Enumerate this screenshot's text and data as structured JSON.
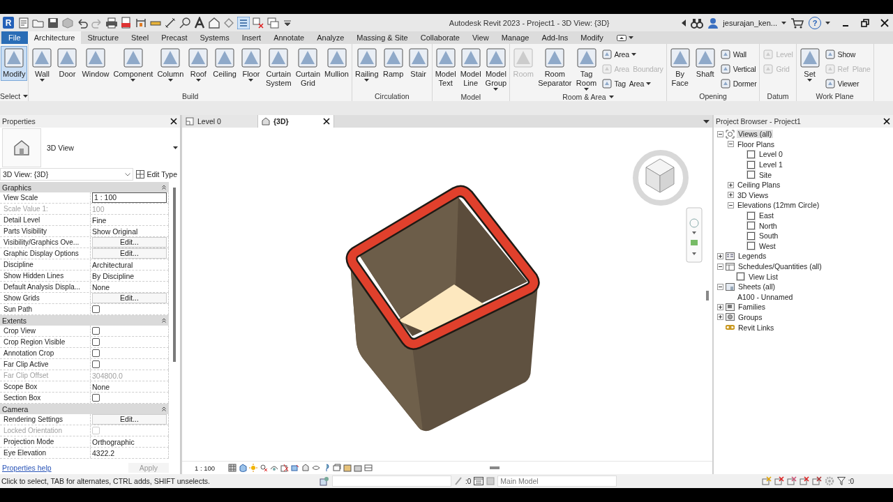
{
  "window": {
    "app_logo": "R",
    "title": "Autodesk Revit 2023 - Project1 - 3D View: {3D}",
    "user": "jesurajan_ken...",
    "help_label": "?"
  },
  "ribbon_tabs": [
    {
      "label": "File",
      "kind": "file",
      "selected": false
    },
    {
      "label": "Architecture",
      "kind": "tab",
      "selected": true
    },
    {
      "label": "Structure",
      "kind": "tab",
      "selected": false
    },
    {
      "label": "Steel",
      "kind": "tab",
      "selected": false
    },
    {
      "label": "Precast",
      "kind": "tab",
      "selected": false
    },
    {
      "label": "Systems",
      "kind": "tab",
      "selected": false
    },
    {
      "label": "Insert",
      "kind": "tab",
      "selected": false
    },
    {
      "label": "Annotate",
      "kind": "tab",
      "selected": false
    },
    {
      "label": "Analyze",
      "kind": "tab",
      "selected": false
    },
    {
      "label": "Massing & Site",
      "kind": "tab",
      "selected": false
    },
    {
      "label": "Collaborate",
      "kind": "tab",
      "selected": false
    },
    {
      "label": "View",
      "kind": "tab",
      "selected": false
    },
    {
      "label": "Manage",
      "kind": "tab",
      "selected": false
    },
    {
      "label": "Add-Ins",
      "kind": "tab",
      "selected": false
    },
    {
      "label": "Modify",
      "kind": "tab",
      "selected": false
    }
  ],
  "ribbon_panels": [
    {
      "title": "Select",
      "has_menu": true,
      "tools": [
        {
          "label": "Modify",
          "kind": "large",
          "selected": true,
          "disabled": false,
          "dropdown": false
        }
      ]
    },
    {
      "title": "Build",
      "has_menu": false,
      "tools": [
        {
          "label": "Wall",
          "kind": "large",
          "selected": false,
          "disabled": false,
          "dropdown": true
        },
        {
          "label": "Door",
          "kind": "large",
          "selected": false,
          "disabled": false,
          "dropdown": false
        },
        {
          "label": "Window",
          "kind": "large",
          "selected": false,
          "disabled": false,
          "dropdown": false
        },
        {
          "label": "Component",
          "kind": "large",
          "selected": false,
          "disabled": false,
          "dropdown": true
        },
        {
          "label": "Column",
          "kind": "large",
          "selected": false,
          "disabled": false,
          "dropdown": true
        },
        {
          "label": "Roof",
          "kind": "large",
          "selected": false,
          "disabled": false,
          "dropdown": true
        },
        {
          "label": "Ceiling",
          "kind": "large",
          "selected": false,
          "disabled": false,
          "dropdown": false
        },
        {
          "label": "Floor",
          "kind": "large",
          "selected": false,
          "disabled": false,
          "dropdown": true
        },
        {
          "label": "Curtain\nSystem",
          "kind": "large",
          "selected": false,
          "disabled": false,
          "dropdown": false
        },
        {
          "label": "Curtain\nGrid",
          "kind": "large",
          "selected": false,
          "disabled": false,
          "dropdown": false
        },
        {
          "label": "Mullion",
          "kind": "large",
          "selected": false,
          "disabled": false,
          "dropdown": false
        }
      ]
    },
    {
      "title": "Circulation",
      "has_menu": false,
      "tools": [
        {
          "label": "Railing",
          "kind": "large",
          "selected": false,
          "disabled": false,
          "dropdown": true
        },
        {
          "label": "Ramp",
          "kind": "large",
          "selected": false,
          "disabled": false,
          "dropdown": false
        },
        {
          "label": "Stair",
          "kind": "large",
          "selected": false,
          "disabled": false,
          "dropdown": false
        }
      ]
    },
    {
      "title": "Model",
      "has_menu": false,
      "tools": [
        {
          "label": "Model\nText",
          "kind": "large",
          "selected": false,
          "disabled": false,
          "dropdown": false
        },
        {
          "label": "Model\nLine",
          "kind": "large",
          "selected": false,
          "disabled": false,
          "dropdown": false
        },
        {
          "label": "Model\nGroup",
          "kind": "large",
          "selected": false,
          "disabled": false,
          "dropdown": true
        }
      ]
    },
    {
      "title": "Room & Area",
      "has_menu": true,
      "tools": [
        {
          "label": "Room",
          "kind": "large",
          "selected": false,
          "disabled": true,
          "dropdown": false
        },
        {
          "label": "Room\nSeparator",
          "kind": "large",
          "selected": false,
          "disabled": false,
          "dropdown": false
        },
        {
          "label": "Tag\nRoom",
          "kind": "large",
          "selected": false,
          "disabled": false,
          "dropdown": true
        },
        {
          "label": "Area",
          "kind": "small",
          "selected": false,
          "disabled": false,
          "dropdown": true
        },
        {
          "label": "Area  Boundary",
          "kind": "small",
          "selected": false,
          "disabled": true,
          "dropdown": false
        },
        {
          "label": "Tag  Area",
          "kind": "small",
          "selected": false,
          "disabled": false,
          "dropdown": true
        }
      ]
    },
    {
      "title": "Opening",
      "has_menu": false,
      "tools": [
        {
          "label": "By\nFace",
          "kind": "large",
          "selected": false,
          "disabled": false,
          "dropdown": false
        },
        {
          "label": "Shaft",
          "kind": "large",
          "selected": false,
          "disabled": false,
          "dropdown": false
        },
        {
          "label": "Wall",
          "kind": "small",
          "selected": false,
          "disabled": false,
          "dropdown": false
        },
        {
          "label": "Vertical",
          "kind": "small",
          "selected": false,
          "disabled": false,
          "dropdown": false
        },
        {
          "label": "Dormer",
          "kind": "small",
          "selected": false,
          "disabled": false,
          "dropdown": false
        }
      ]
    },
    {
      "title": "Datum",
      "has_menu": false,
      "tools": [
        {
          "label": "Level",
          "kind": "small",
          "selected": false,
          "disabled": true,
          "dropdown": false
        },
        {
          "label": "Grid",
          "kind": "small",
          "selected": false,
          "disabled": true,
          "dropdown": false
        }
      ]
    },
    {
      "title": "Work Plane",
      "has_menu": false,
      "tools": [
        {
          "label": "Set",
          "kind": "large",
          "selected": false,
          "disabled": false,
          "dropdown": true
        },
        {
          "label": "Show",
          "kind": "small",
          "selected": false,
          "disabled": false,
          "dropdown": false
        },
        {
          "label": "Ref  Plane",
          "kind": "small",
          "selected": false,
          "disabled": true,
          "dropdown": false
        },
        {
          "label": "Viewer",
          "kind": "small",
          "selected": false,
          "disabled": false,
          "dropdown": false
        }
      ]
    }
  ],
  "properties": {
    "title": "Properties",
    "type_name": "3D View",
    "instance_selector": "3D View: {3D}",
    "edit_type": "Edit Type",
    "help_link": "Properties help",
    "apply": "Apply",
    "groups": [
      {
        "title": "Graphics",
        "rows": [
          {
            "name": "View Scale",
            "kind": "field",
            "value": "1 : 100",
            "disabled": false
          },
          {
            "name": "Scale Value    1:",
            "kind": "text",
            "value": "100",
            "disabled": true
          },
          {
            "name": "Detail Level",
            "kind": "text",
            "value": "Fine",
            "disabled": false
          },
          {
            "name": "Parts Visibility",
            "kind": "text",
            "value": "Show Original",
            "disabled": false
          },
          {
            "name": "Visibility/Graphics Ove...",
            "kind": "button",
            "value": "Edit...",
            "disabled": false
          },
          {
            "name": "Graphic Display Options",
            "kind": "button",
            "value": "Edit...",
            "disabled": false
          },
          {
            "name": "Discipline",
            "kind": "text",
            "value": "Architectural",
            "disabled": false
          },
          {
            "name": "Show Hidden Lines",
            "kind": "text",
            "value": "By Discipline",
            "disabled": false
          },
          {
            "name": "Default Analysis Displa...",
            "kind": "text",
            "value": "None",
            "disabled": false
          },
          {
            "name": "Show Grids",
            "kind": "button",
            "value": "Edit...",
            "disabled": false
          },
          {
            "name": "Sun Path",
            "kind": "checkbox",
            "checked": false,
            "disabled": false
          }
        ]
      },
      {
        "title": "Extents",
        "rows": [
          {
            "name": "Crop View",
            "kind": "checkbox",
            "checked": false,
            "disabled": false
          },
          {
            "name": "Crop Region Visible",
            "kind": "checkbox",
            "checked": false,
            "disabled": false
          },
          {
            "name": "Annotation Crop",
            "kind": "checkbox",
            "checked": false,
            "disabled": false
          },
          {
            "name": "Far Clip Active",
            "kind": "checkbox",
            "checked": false,
            "disabled": false
          },
          {
            "name": "Far Clip Offset",
            "kind": "text",
            "value": "304800.0",
            "disabled": true
          },
          {
            "name": "Scope Box",
            "kind": "text",
            "value": "None",
            "disabled": false
          },
          {
            "name": "Section Box",
            "kind": "checkbox",
            "checked": false,
            "disabled": false
          }
        ]
      },
      {
        "title": "Camera",
        "rows": [
          {
            "name": "Rendering Settings",
            "kind": "button",
            "value": "Edit...",
            "disabled": false
          },
          {
            "name": "Locked Orientation",
            "kind": "checkbox",
            "checked": false,
            "disabled": true
          },
          {
            "name": "Projection Mode",
            "kind": "text",
            "value": "Orthographic",
            "disabled": false
          },
          {
            "name": "Eye Elevation",
            "kind": "text",
            "value": "4322.2",
            "disabled": false
          }
        ]
      }
    ]
  },
  "view_tabs": [
    {
      "label": "Level 0",
      "kind": "plan",
      "selected": false
    },
    {
      "label": "{3D}",
      "kind": "model",
      "selected": true
    }
  ],
  "view_control_bar": {
    "scale": "1 : 100"
  },
  "project_browser": {
    "title": "Project Browser - Project1",
    "tree": [
      {
        "label": "Views (all)",
        "kind": "views",
        "expanded": true,
        "selected": true,
        "children": [
          {
            "label": "Floor Plans",
            "kind": "folder",
            "expanded": true,
            "selected": false,
            "children": [
              {
                "label": "Level 0",
                "kind": "view",
                "selected": false
              },
              {
                "label": "Level 1",
                "kind": "view",
                "selected": false
              },
              {
                "label": "Site",
                "kind": "view",
                "selected": false
              }
            ]
          },
          {
            "label": "Ceiling Plans",
            "kind": "folder",
            "expanded": false,
            "selected": false
          },
          {
            "label": "3D Views",
            "kind": "folder",
            "expanded": false,
            "selected": false
          },
          {
            "label": "Elevations (12mm Circle)",
            "kind": "folder",
            "expanded": true,
            "selected": false,
            "children": [
              {
                "label": "East",
                "kind": "view",
                "selected": false
              },
              {
                "label": "North",
                "kind": "view",
                "selected": false
              },
              {
                "label": "South",
                "kind": "view",
                "selected": false
              },
              {
                "label": "West",
                "kind": "view",
                "selected": false
              }
            ]
          }
        ]
      },
      {
        "label": "Legends",
        "kind": "legend",
        "expanded": false,
        "selected": false
      },
      {
        "label": "Schedules/Quantities (all)",
        "kind": "schedule",
        "expanded": true,
        "selected": false,
        "children": [
          {
            "label": "View List",
            "kind": "view",
            "selected": false
          }
        ]
      },
      {
        "label": "Sheets (all)",
        "kind": "sheet",
        "expanded": true,
        "selected": false,
        "children": [
          {
            "label": "A100 - Unnamed",
            "kind": "plain",
            "selected": false
          }
        ]
      },
      {
        "label": "Families",
        "kind": "family",
        "expanded": false,
        "selected": false
      },
      {
        "label": "Groups",
        "kind": "group",
        "expanded": false,
        "selected": false
      },
      {
        "label": "Revit Links",
        "kind": "link",
        "selected": false
      }
    ]
  },
  "status_bar": {
    "message": "Click to select, TAB for alternates, CTRL adds, SHIFT unselects.",
    "selection_count": ":0",
    "active_model": "Main Model",
    "filter_count": ":0"
  }
}
